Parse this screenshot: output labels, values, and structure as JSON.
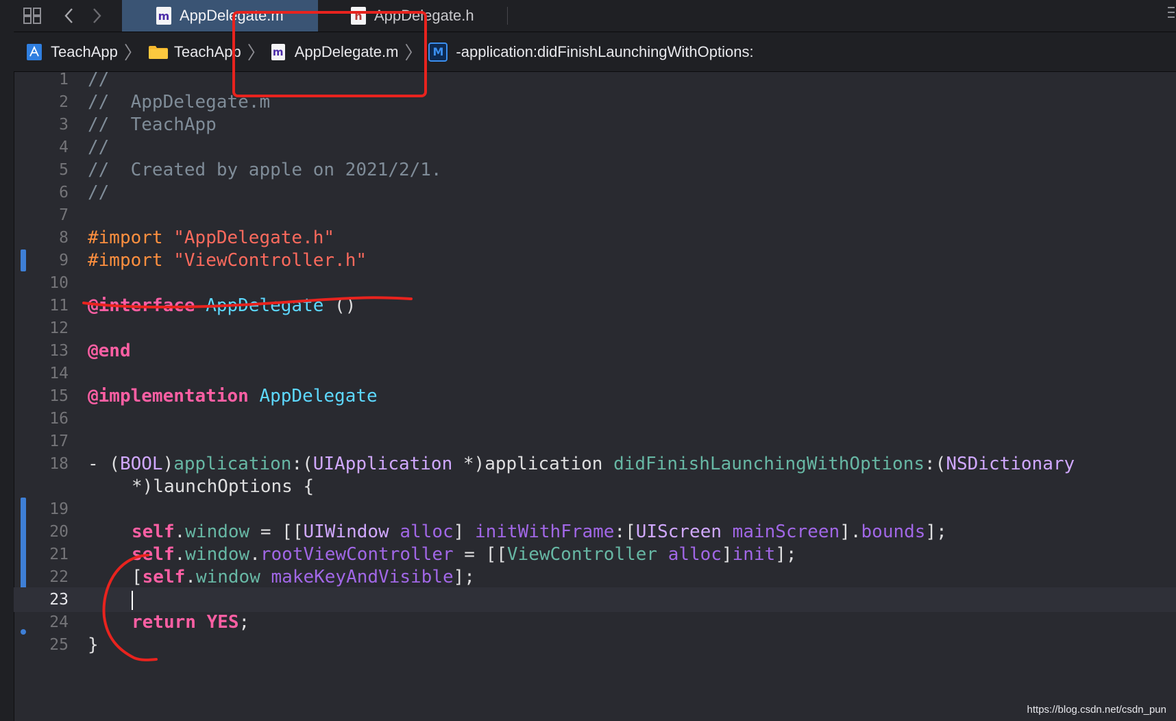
{
  "tabs": [
    {
      "label": "AppDelegate.m",
      "icon": "m",
      "active": true
    },
    {
      "label": "AppDelegate.h",
      "icon": "h",
      "active": false
    }
  ],
  "jumpbar": {
    "project": "TeachApp",
    "folder": "TeachApp",
    "file": "AppDelegate.m",
    "method_icon": "M",
    "method": "-application:didFinishLaunchingWithOptions:"
  },
  "code": {
    "line_numbers": [
      "1",
      "2",
      "3",
      "4",
      "5",
      "6",
      "7",
      "8",
      "9",
      "10",
      "11",
      "12",
      "13",
      "14",
      "15",
      "16",
      "17",
      "18",
      "19",
      "20",
      "21",
      "22",
      "23",
      "24",
      "25"
    ],
    "l1": "//",
    "l2": "//  AppDelegate.m",
    "l3": "//  TeachApp",
    "l4": "//",
    "l5": "//  Created by apple on 2021/2/1.",
    "l6": "//",
    "l8_kw": "#import",
    "l8_str": "\"AppDelegate.h\"",
    "l9_kw": "#import",
    "l9_str": "\"ViewController.h\"",
    "l11_kw": "@interface",
    "l11_cls": "AppDelegate",
    "l11_rest": "()",
    "l13_kw": "@end",
    "l15_kw": "@implementation",
    "l15_cls": "AppDelegate",
    "l18_a": "- (",
    "l18_bool": "BOOL",
    "l18_b": ")",
    "l18_app": "application",
    "l18_c": ":(",
    "l18_uiapp": "UIApplication",
    "l18_d": " *)application ",
    "l18_dfl": "didFinishLaunchingWithOptions",
    "l18_e": ":(",
    "l18_nsd": "NSDictionary",
    "l18_cont": "*)launchOptions {",
    "l20": {
      "self": "self",
      "dot1": ".",
      "window": "window",
      "eq": " = [[",
      "uiwindow": "UIWindow",
      "sp1": " ",
      "alloc": "alloc",
      "rb": "] ",
      "iwf": "initWithFrame",
      "colon": ":[",
      "uiscreen": "UIScreen",
      "sp2": " ",
      "mainscreen": "mainScreen",
      "rb2": "].",
      "bounds": "bounds",
      "end": "];"
    },
    "l21": {
      "self": "self",
      "dot1": ".",
      "window": "window",
      "dot2": ".",
      "rvc": "rootViewController",
      "eq": " = [[",
      "vc": "ViewController",
      "sp": " ",
      "alloc": "alloc",
      "rb": "]",
      "init": "init",
      "end": "];"
    },
    "l22": {
      "lb": "[",
      "self": "self",
      "dot": ".",
      "window": "window",
      "sp": " ",
      "mkv": "makeKeyAndVisible",
      "end": "];"
    },
    "l24_kw": "return",
    "l24_yes": "YES",
    "l24_end": ";",
    "l25": "}"
  },
  "watermark": "https://blog.csdn.net/csdn_pun",
  "colors": {
    "background": "#292a30",
    "active_tab": "#3a5474",
    "annotation_red": "#e8231e",
    "change_bar": "#3e7fd6"
  }
}
